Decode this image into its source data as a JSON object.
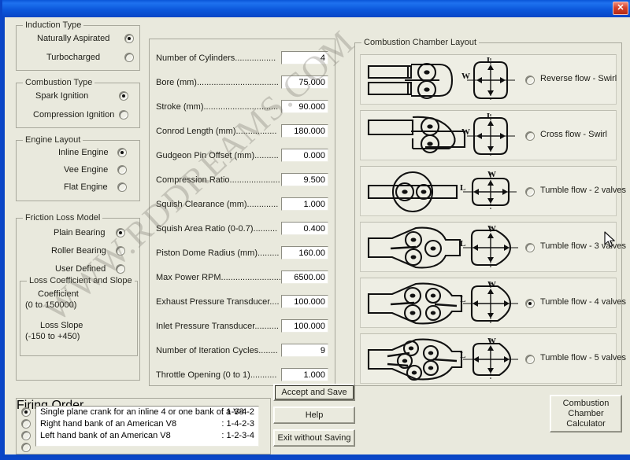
{
  "window": {
    "title": "",
    "close_label": "✕"
  },
  "induction": {
    "title": "Induction Type",
    "options": [
      {
        "label": "Naturally Aspirated",
        "selected": true
      },
      {
        "label": "Turbocharged",
        "selected": false
      }
    ]
  },
  "combustion_type": {
    "title": "Combustion Type",
    "options": [
      {
        "label": "Spark Ignition",
        "selected": true
      },
      {
        "label": "Compression Ignition",
        "selected": false
      }
    ]
  },
  "engine_layout": {
    "title": "Engine Layout",
    "options": [
      {
        "label": "Inline Engine",
        "selected": true
      },
      {
        "label": "Vee Engine",
        "selected": false
      },
      {
        "label": "Flat Engine",
        "selected": false
      }
    ]
  },
  "friction_loss": {
    "title": "Friction Loss Model",
    "options": [
      {
        "label": "Plain Bearing",
        "selected": true
      },
      {
        "label": "Roller Bearing",
        "selected": false
      },
      {
        "label": "User Defined",
        "selected": false
      }
    ],
    "loss_box": {
      "title": "Loss Coefficient and Slope",
      "coefficient_label": "Coefficient",
      "coefficient_range": "(0 to 150000)",
      "slope_label": "Loss Slope",
      "slope_range": "(-150 to +450)"
    }
  },
  "parameters": [
    {
      "label": "Number of Cylinders.................",
      "value": "4"
    },
    {
      "label": "Bore (mm)..................................",
      "value": "75.000"
    },
    {
      "label": "Stroke (mm)...............................",
      "value": "90.000"
    },
    {
      "label": "Conrod Length (mm).................",
      "value": "180.000"
    },
    {
      "label": "Gudgeon Pin Offset (mm)..........",
      "value": "0.000"
    },
    {
      "label": "Compression Ratio.....................",
      "value": "9.500"
    },
    {
      "label": "Squish Clearance (mm).............",
      "value": "1.000"
    },
    {
      "label": "Squish Area Ratio (0-0.7)..........",
      "value": "0.400"
    },
    {
      "label": "Piston Dome Radius (mm).........",
      "value": "160.00"
    },
    {
      "label": "Max Power RPM.........................",
      "value": "6500.00"
    },
    {
      "label": "Exhaust Pressure Transducer....",
      "value": "100.000"
    },
    {
      "label": "Inlet Pressure Transducer..........",
      "value": "100.000"
    },
    {
      "label": "Number of Iteration Cycles........",
      "value": "9"
    },
    {
      "label": "Throttle Opening (0 to 1)...........",
      "value": "1.000"
    }
  ],
  "chamber": {
    "title": "Combustion Chamber Layout",
    "dim_w": "W",
    "dim_l": "L",
    "options": [
      {
        "label": "Reverse flow - Swirl",
        "selected": false
      },
      {
        "label": "Cross flow - Swirl",
        "selected": false
      },
      {
        "label": "Tumble flow - 2 valves",
        "selected": false
      },
      {
        "label": "Tumble flow - 3 valves",
        "selected": false
      },
      {
        "label": "Tumble flow - 4 valves",
        "selected": true
      },
      {
        "label": "Tumble flow - 5 valves",
        "selected": false
      }
    ]
  },
  "firing_order": {
    "title": "Firing Order",
    "items": [
      {
        "text": "Single plane crank for an inline 4 or one bank of a V8",
        "code": ": 1-3-4-2",
        "selected": true
      },
      {
        "text": "Right hand bank of an American V8",
        "code": ": 1-4-2-3",
        "selected": false
      },
      {
        "text": "Left hand bank of an American V8",
        "code": ": 1-2-3-4",
        "selected": false
      },
      {
        "text": "",
        "code": "",
        "selected": false
      }
    ]
  },
  "buttons": {
    "accept": "Accept and Save",
    "help": "Help",
    "exit": "Exit without Saving",
    "calculator_line1": "Combustion",
    "calculator_line2": "Chamber",
    "calculator_line3": "Calculator"
  },
  "watermark": {
    "text": "WWW.RDDREAMS.COM"
  }
}
